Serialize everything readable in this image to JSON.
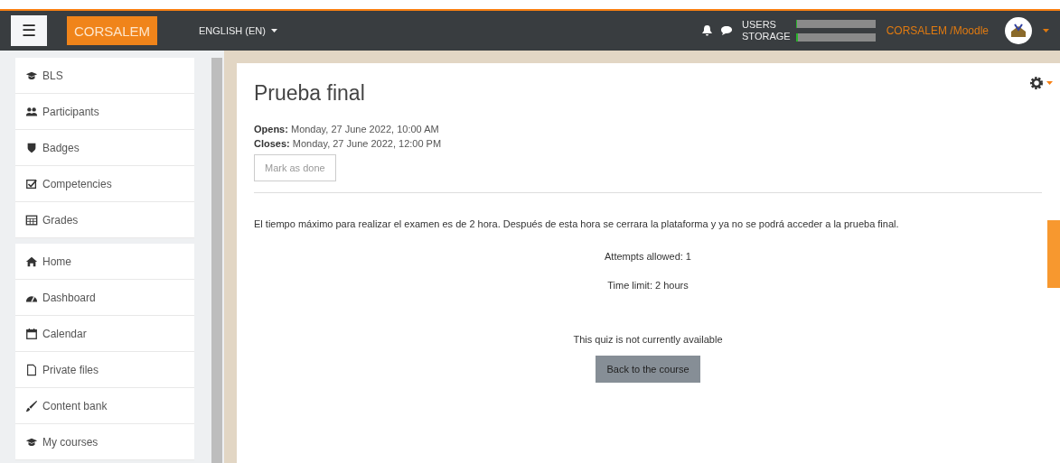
{
  "navbar": {
    "menu_glyph": "☰",
    "brand": "CORSALEM",
    "language": "ENGLISH (EN)",
    "usage": [
      {
        "label": "USERS",
        "level": 0.01
      },
      {
        "label": "STORAGE",
        "level": 0.03
      }
    ],
    "site_name": "CORSALEM /Moodle"
  },
  "sidebar": {
    "groups": [
      [
        {
          "label": "BLS"
        },
        {
          "label": "Participants"
        },
        {
          "label": "Badges"
        },
        {
          "label": "Competencies"
        },
        {
          "label": "Grades"
        }
      ],
      [
        {
          "label": "Home"
        },
        {
          "label": "Dashboard"
        },
        {
          "label": "Calendar"
        },
        {
          "label": "Private files"
        },
        {
          "label": "Content bank"
        },
        {
          "label": "My courses"
        }
      ]
    ]
  },
  "page": {
    "title": "Prueba final",
    "dates": [
      {
        "label": "Opens:",
        "value": "Monday, 27 June 2022, 10:00 AM"
      },
      {
        "label": "Closes:",
        "value": "Monday, 27 June 2022, 12:00 PM"
      }
    ],
    "mark_done": "Mark as done",
    "intro": "El tiempo máximo para realizar el examen es de 2 hora. Después de esta hora se cerrara la plataforma y ya no se podrá acceder a la prueba final.",
    "info": [
      "Attempts allowed: 1",
      "Time limit: 2 hours"
    ],
    "notice": "This quiz is not currently available",
    "back_button": "Back to the course"
  }
}
